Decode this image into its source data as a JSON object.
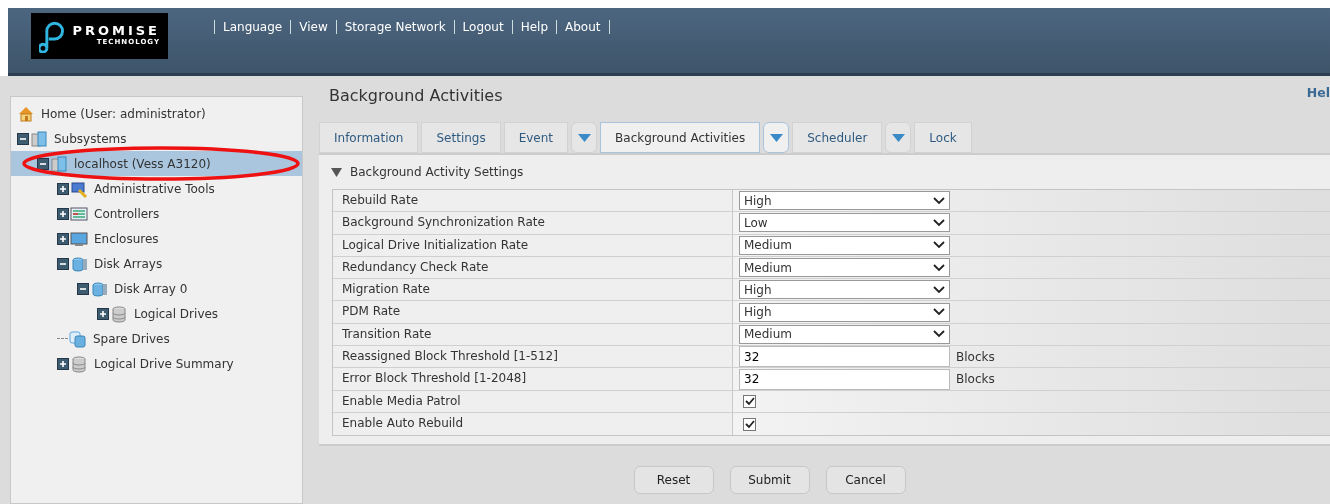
{
  "header": {
    "logo": {
      "name": "PROMISE",
      "tagline": "TECHNOLOGY"
    },
    "menu": [
      "Language",
      "View",
      "Storage Network",
      "Logout",
      "Help",
      "About"
    ]
  },
  "tree": [
    {
      "kind": "home",
      "label": "Home (User: administrator)",
      "selected": false
    },
    {
      "kind": "system",
      "label": "Subsystems",
      "expanded": true,
      "selected": false,
      "children": [
        {
          "kind": "system",
          "label": "localhost (Vess A3120)",
          "expanded": true,
          "selected": true,
          "highlighted": true,
          "children": [
            {
              "kind": "tools",
              "label": "Administrative Tools",
              "expanded": false,
              "selected": false
            },
            {
              "kind": "controller",
              "label": "Controllers",
              "expanded": false,
              "selected": false
            },
            {
              "kind": "enclosure",
              "label": "Enclosures",
              "expanded": false,
              "selected": false
            },
            {
              "kind": "array",
              "label": "Disk Arrays",
              "expanded": true,
              "selected": false,
              "children": [
                {
                  "kind": "array",
                  "label": "Disk Array 0",
                  "expanded": true,
                  "selected": false,
                  "children": [
                    {
                      "kind": "drive",
                      "label": "Logical Drives",
                      "expanded": false,
                      "selected": false
                    }
                  ]
                }
              ]
            },
            {
              "kind": "spare",
              "label": "Spare Drives",
              "selected": false
            },
            {
              "kind": "drive",
              "label": "Logical Drive Summary",
              "expanded": false,
              "selected": false
            }
          ]
        }
      ]
    }
  ],
  "page": {
    "title": "Background Activities",
    "help": "Hel"
  },
  "tabs": [
    {
      "label": "Information",
      "selected": false,
      "menu": false
    },
    {
      "label": "Settings",
      "selected": false,
      "menu": false
    },
    {
      "label": "Event",
      "selected": false,
      "menu": true
    },
    {
      "label": "Background Activities",
      "selected": true,
      "menu": true
    },
    {
      "label": "Scheduler",
      "selected": false,
      "menu": true
    },
    {
      "label": "Lock",
      "selected": false,
      "menu": false
    }
  ],
  "section": {
    "title": "Background Activity Settings",
    "expanded": true
  },
  "settings": [
    {
      "kind": "select",
      "label": "Rebuild Rate",
      "value": "High"
    },
    {
      "kind": "select",
      "label": "Background Synchronization Rate",
      "value": "Low"
    },
    {
      "kind": "select",
      "label": "Logical Drive Initialization Rate",
      "value": "Medium"
    },
    {
      "kind": "select",
      "label": "Redundancy Check Rate",
      "value": "Medium"
    },
    {
      "kind": "select",
      "label": "Migration Rate",
      "value": "High"
    },
    {
      "kind": "select",
      "label": "PDM Rate",
      "value": "High"
    },
    {
      "kind": "select",
      "label": "Transition Rate",
      "value": "Medium"
    },
    {
      "kind": "number",
      "label": "Reassigned Block Threshold [1-512]",
      "value": "32",
      "unit": "Blocks"
    },
    {
      "kind": "number",
      "label": "Error Block Threshold [1-2048]",
      "value": "32",
      "unit": "Blocks"
    },
    {
      "kind": "checkbox",
      "label": "Enable Media Patrol",
      "checked": true
    },
    {
      "kind": "checkbox",
      "label": "Enable Auto Rebuild",
      "checked": true
    }
  ],
  "buttons": [
    "Reset",
    "Submit",
    "Cancel"
  ]
}
